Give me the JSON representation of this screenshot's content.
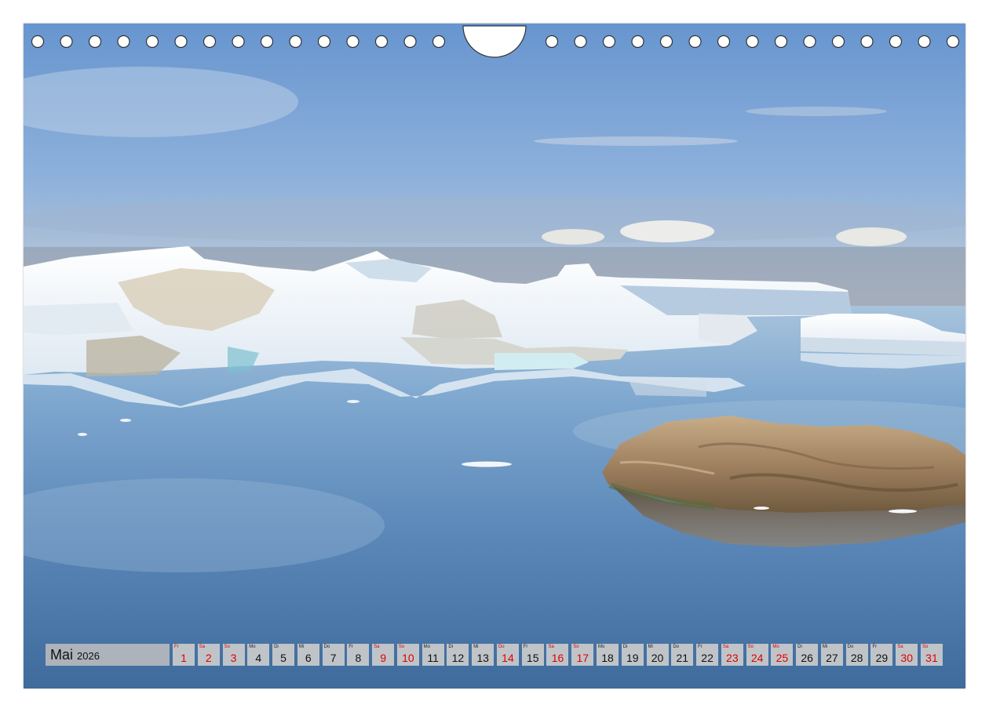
{
  "calendar": {
    "month": "Mai",
    "year": "2026",
    "days": [
      {
        "dow": "Fr",
        "num": "1",
        "red": true
      },
      {
        "dow": "Sa",
        "num": "2",
        "red": true
      },
      {
        "dow": "So",
        "num": "3",
        "red": true
      },
      {
        "dow": "Mo",
        "num": "4",
        "red": false
      },
      {
        "dow": "Di",
        "num": "5",
        "red": false
      },
      {
        "dow": "Mi",
        "num": "6",
        "red": false
      },
      {
        "dow": "Do",
        "num": "7",
        "red": false
      },
      {
        "dow": "Fr",
        "num": "8",
        "red": false
      },
      {
        "dow": "Sa",
        "num": "9",
        "red": true
      },
      {
        "dow": "So",
        "num": "10",
        "red": true
      },
      {
        "dow": "Mo",
        "num": "11",
        "red": false
      },
      {
        "dow": "Di",
        "num": "12",
        "red": false
      },
      {
        "dow": "Mi",
        "num": "13",
        "red": false
      },
      {
        "dow": "Do",
        "num": "14",
        "red": true
      },
      {
        "dow": "Fr",
        "num": "15",
        "red": false
      },
      {
        "dow": "Sa",
        "num": "16",
        "red": true
      },
      {
        "dow": "So",
        "num": "17",
        "red": true
      },
      {
        "dow": "Mo",
        "num": "18",
        "red": false
      },
      {
        "dow": "Di",
        "num": "19",
        "red": false
      },
      {
        "dow": "Mi",
        "num": "20",
        "red": false
      },
      {
        "dow": "Do",
        "num": "21",
        "red": false
      },
      {
        "dow": "Fr",
        "num": "22",
        "red": false
      },
      {
        "dow": "Sa",
        "num": "23",
        "red": true
      },
      {
        "dow": "So",
        "num": "24",
        "red": true
      },
      {
        "dow": "Mo",
        "num": "25",
        "red": true
      },
      {
        "dow": "Di",
        "num": "26",
        "red": false
      },
      {
        "dow": "Mi",
        "num": "27",
        "red": false
      },
      {
        "dow": "Do",
        "num": "28",
        "red": false
      },
      {
        "dow": "Fr",
        "num": "29",
        "red": false
      },
      {
        "dow": "Sa",
        "num": "30",
        "red": true
      },
      {
        "dow": "So",
        "num": "31",
        "red": true
      }
    ]
  },
  "colors": {
    "sky_top": "#6f9ed3",
    "sky_horizon": "#b9c6d6",
    "water_top": "#8fb6d8",
    "water_bottom": "#3f6fa0",
    "ice": "#f3f7fa",
    "rock": "#a48a68",
    "holiday_red": "#e00000"
  }
}
